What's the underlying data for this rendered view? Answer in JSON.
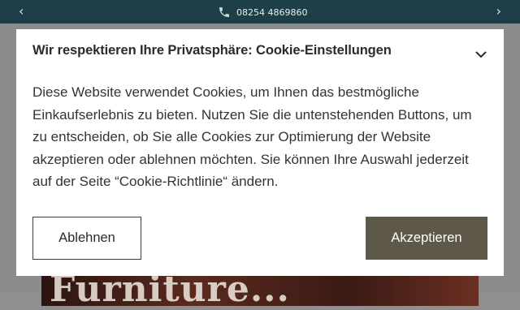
{
  "topbar": {
    "phone": "08254 4869860",
    "prev_icon": "chevron-left-icon",
    "next_icon": "chevron-right-icon"
  },
  "hero": {
    "text": "Furniture..."
  },
  "cookie_modal": {
    "title": "Wir respektieren Ihre Privatsphäre: Cookie-Einstellungen",
    "body": "Diese Website verwendet Cookies, um Ihnen das bestmögliche Einkaufserlebnis zu bieten. Nutzen Sie die untenstehenden Buttons, um zu entscheiden, ob Sie alle Cookies zur Optimierung der Website akzeptieren oder ablehnen möchten. Sie können Ihre Auswahl jederzeit auf der Seite “Cookie-Richtlinie“ ändern.",
    "reject_label": "Ablehnen",
    "accept_label": "Akzeptieren"
  },
  "colors": {
    "topbar": "#1f3f48",
    "accept_button": "#5d5848",
    "overlay": "#8c8c8c"
  }
}
